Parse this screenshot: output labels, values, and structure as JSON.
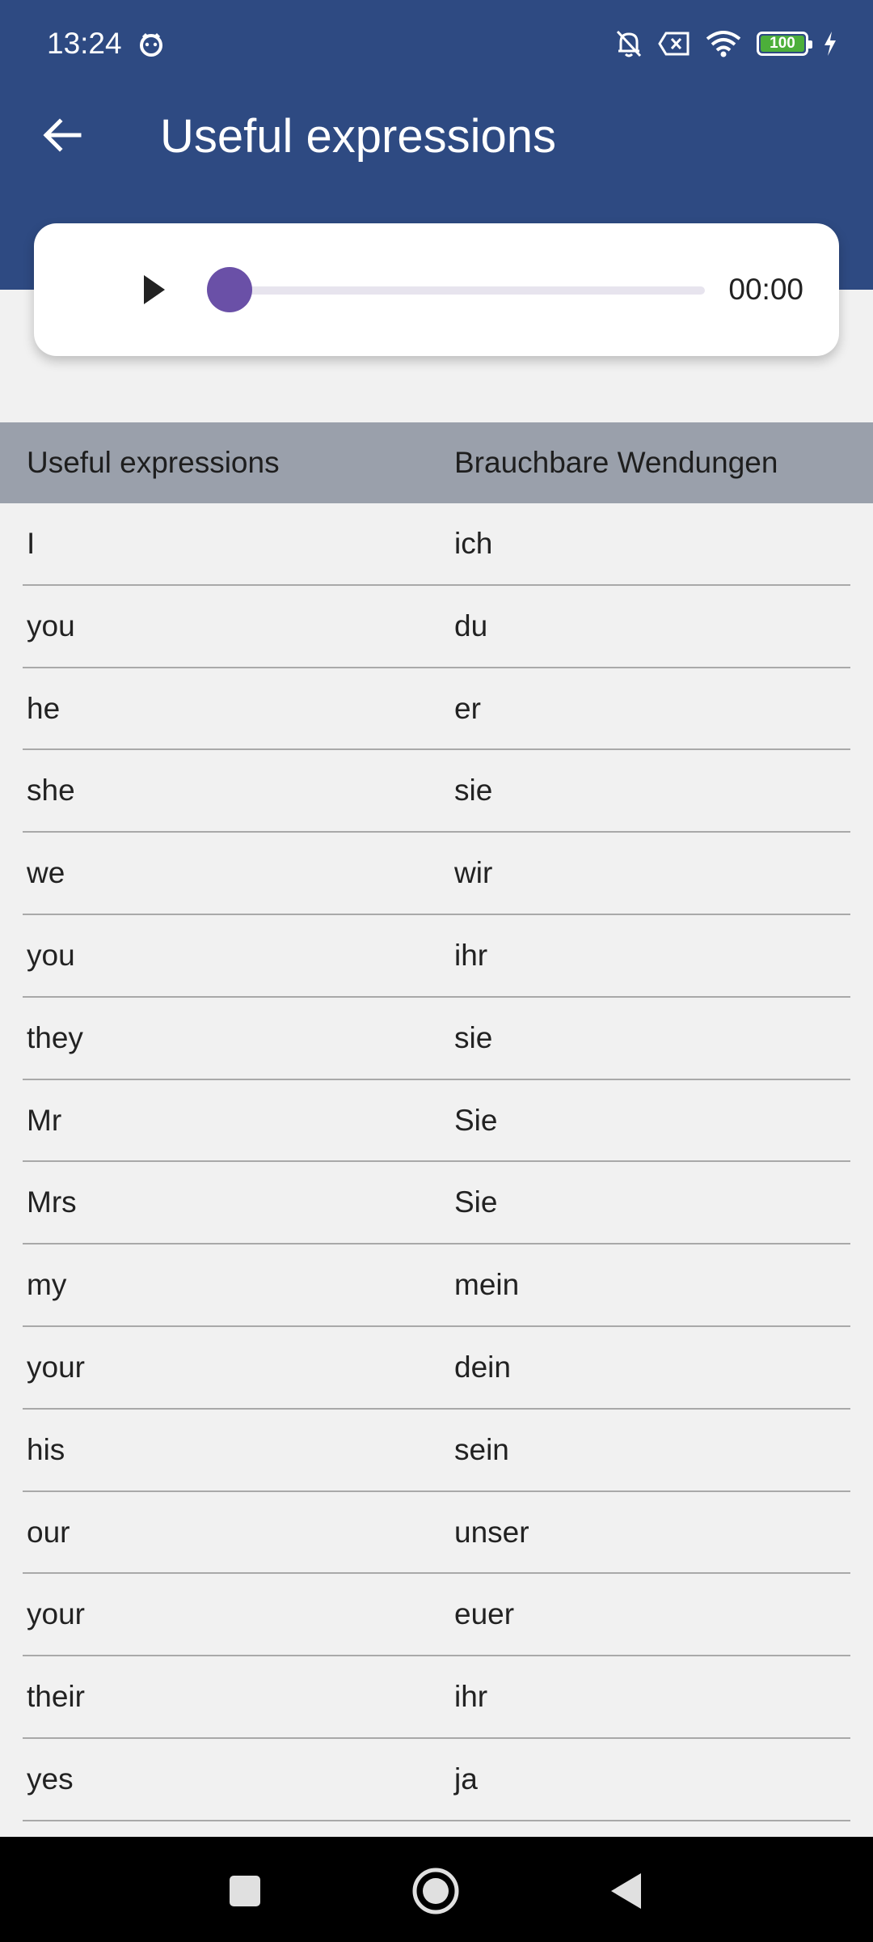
{
  "status_bar": {
    "time": "13:24",
    "battery": "100",
    "icons": [
      "face-icon",
      "bell-off-icon",
      "sim-off-icon",
      "wifi-icon",
      "battery-icon",
      "charging-icon"
    ]
  },
  "app_bar": {
    "title": "Useful expressions",
    "back_icon": "arrow-back-icon",
    "color": "#2e4a82"
  },
  "player": {
    "play_icon": "play-icon",
    "progress": 0,
    "time": "00:00",
    "thumb_color": "#6a50a7"
  },
  "table": {
    "headers": [
      "Useful expressions",
      "Brauchbare Wendungen"
    ],
    "rows": [
      [
        "I",
        "ich"
      ],
      [
        "you",
        "du"
      ],
      [
        "he",
        "er"
      ],
      [
        "she",
        "sie"
      ],
      [
        "we",
        "wir"
      ],
      [
        "you",
        "ihr"
      ],
      [
        "they",
        "sie"
      ],
      [
        "Mr",
        "Sie"
      ],
      [
        "Mrs",
        "Sie"
      ],
      [
        "my",
        "mein"
      ],
      [
        "your",
        "dein"
      ],
      [
        "his",
        "sein"
      ],
      [
        "our",
        "unser"
      ],
      [
        "your",
        "euer"
      ],
      [
        "their",
        "ihr"
      ],
      [
        "yes",
        "ja"
      ]
    ]
  },
  "nav_bar": {
    "icons": [
      "recents-icon",
      "home-icon",
      "back-icon"
    ]
  }
}
